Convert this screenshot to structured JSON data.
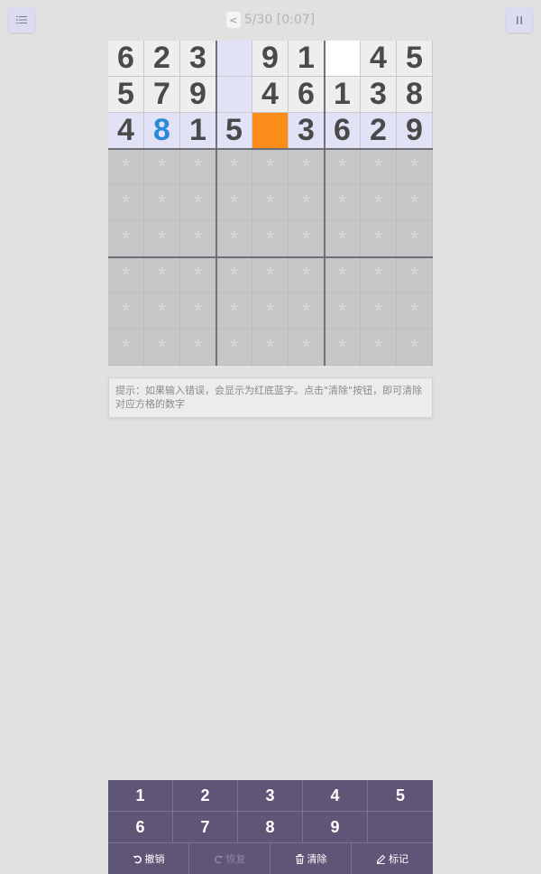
{
  "header": {
    "prev_label": "<",
    "level_status": "5/30 [0:07]"
  },
  "board": {
    "rows": [
      [
        "6",
        "2",
        "3",
        "",
        "9",
        "1",
        "",
        "4",
        "5"
      ],
      [
        "5",
        "7",
        "9",
        "",
        "4",
        "6",
        "1",
        "3",
        "8"
      ],
      [
        "4",
        "8",
        "1",
        "5",
        "",
        "3",
        "6",
        "2",
        "9"
      ]
    ],
    "masked_symbol": "*",
    "selected_cell": [
      2,
      4
    ],
    "entered_cells": [
      [
        2,
        1
      ]
    ],
    "empty_highlight_cells": [
      [
        0,
        3
      ],
      [
        1,
        3
      ]
    ],
    "white_cells": [
      [
        0,
        6
      ]
    ]
  },
  "hint": {
    "text": "提示：如果输入错误，会显示为红底蓝字。点击\"清除\"按钮，即可清除对应方格的数字"
  },
  "keypad": {
    "numbers": [
      "1",
      "2",
      "3",
      "4",
      "5",
      "6",
      "7",
      "8",
      "9"
    ],
    "actions": {
      "undo": "撤销",
      "redo": "恢复",
      "clear": "清除",
      "mark": "标记"
    }
  },
  "colors": {
    "background": "#e1e1e1",
    "given_cell": "#eeeeee",
    "highlight_row": "#e2e2f6",
    "selected_cell": "#fc8c1a",
    "entered_digit": "#2a8ad8",
    "masked_area": "#c6c6c6",
    "keypad": "#5f5576"
  },
  "icons": {
    "menu": "list-icon",
    "pause": "pause-icon",
    "undo": "undo-icon",
    "redo": "redo-icon",
    "clear": "trash-icon",
    "mark": "pencil-icon"
  }
}
